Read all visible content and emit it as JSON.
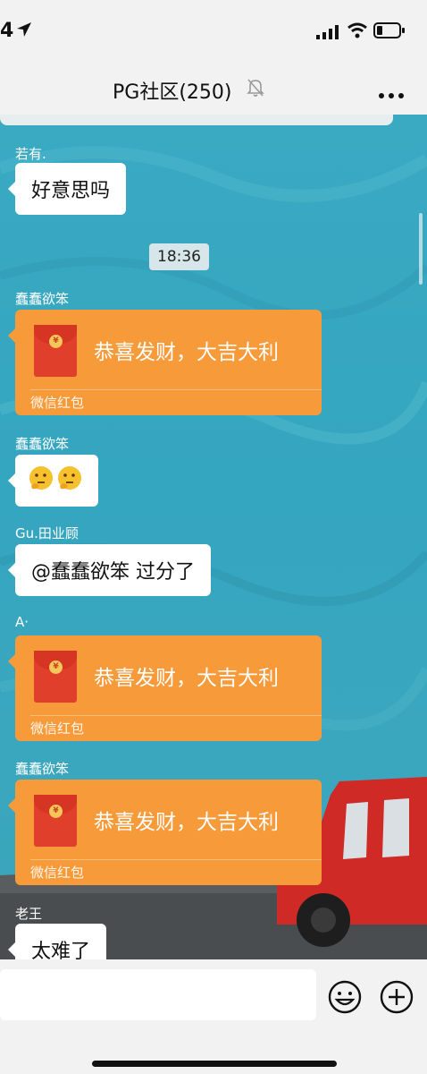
{
  "status_bar": {
    "time": "4",
    "icons": [
      "location-arrow-icon",
      "cellular-signal-icon",
      "wifi-icon",
      "battery-icon"
    ]
  },
  "nav": {
    "title": "PG社区(250)",
    "icons": [
      "mute-bell-icon",
      "more-options-icon"
    ]
  },
  "chat": {
    "time_divider": "18:36",
    "messages": [
      {
        "sender": "若有.",
        "type": "text",
        "text": "好意思吗"
      },
      {
        "sender": "蠢蠢欲笨",
        "type": "red_packet",
        "title": "恭喜发财，大吉大利",
        "label": "微信红包"
      },
      {
        "sender": "蠢蠢欲笨",
        "type": "emoji",
        "emojis": [
          "thinking-face-icon",
          "thinking-face-icon"
        ]
      },
      {
        "sender": "Gu.田业顾",
        "type": "text",
        "text": "@蠢蠢欲笨 过分了"
      },
      {
        "sender": "A·",
        "type": "red_packet",
        "title": "恭喜发财，大吉大利",
        "label": "微信红包"
      },
      {
        "sender": "蠢蠢欲笨",
        "type": "red_packet",
        "title": "恭喜发财，大吉大利",
        "label": "微信红包"
      },
      {
        "sender": "老王",
        "type": "text",
        "text": "太难了"
      }
    ],
    "red_packet_coin": "¥"
  },
  "input_bar": {
    "icons": [
      "emoji-icon",
      "plus-icon"
    ]
  },
  "colors": {
    "chat_background": "#39a6bf",
    "red_packet": "#f79a3a",
    "red_envelope": "#e0402b"
  }
}
